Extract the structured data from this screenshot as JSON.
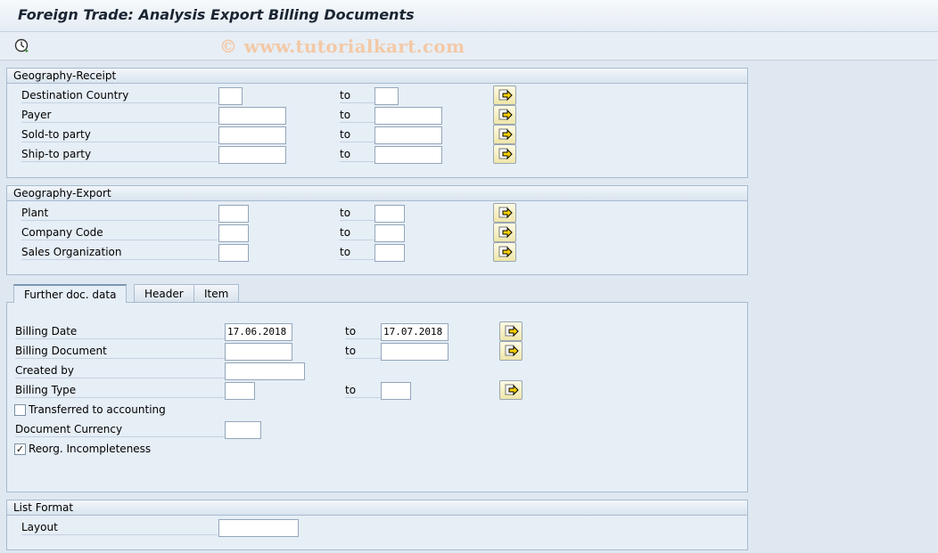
{
  "window": {
    "title": "Foreign Trade: Analysis Export Billing Documents"
  },
  "toolbar": {
    "execute_icon": "clock-execute-icon",
    "watermark": "© www.tutorialkart.com"
  },
  "geography_receipt": {
    "title": "Geography-Receipt",
    "rows": [
      {
        "label": "Destination Country",
        "from": "",
        "to_label": "to",
        "to": ""
      },
      {
        "label": "Payer",
        "from": "",
        "to_label": "to",
        "to": ""
      },
      {
        "label": "Sold-to party",
        "from": "",
        "to_label": "to",
        "to": ""
      },
      {
        "label": "Ship-to party",
        "from": "",
        "to_label": "to",
        "to": ""
      }
    ]
  },
  "geography_export": {
    "title": "Geography-Export",
    "rows": [
      {
        "label": "Plant",
        "from": "",
        "to_label": "to",
        "to": ""
      },
      {
        "label": "Company Code",
        "from": "",
        "to_label": "to",
        "to": ""
      },
      {
        "label": "Sales Organization",
        "from": "",
        "to_label": "to",
        "to": ""
      }
    ]
  },
  "tabs": [
    {
      "label": "Further doc. data",
      "active": true
    },
    {
      "label": "Header",
      "active": false
    },
    {
      "label": "Item",
      "active": false
    }
  ],
  "further": {
    "billing_date": {
      "label": "Billing Date",
      "from": "17.06.2018",
      "to_label": "to",
      "to": "17.07.2018"
    },
    "billing_document": {
      "label": "Billing Document",
      "from": "",
      "to_label": "to",
      "to": ""
    },
    "created_by": {
      "label": "Created by",
      "value": ""
    },
    "billing_type": {
      "label": "Billing Type",
      "from": "",
      "to_label": "to",
      "to": ""
    },
    "transferred": {
      "label": "Transferred to accounting",
      "checked": false
    },
    "document_currency": {
      "label": "Document Currency",
      "value": ""
    },
    "reorg": {
      "label": "Reorg. Incompleteness",
      "checked": true,
      "mark": "✓"
    }
  },
  "list_format": {
    "title": "List Format",
    "layout_label": "Layout",
    "layout_value": ""
  },
  "colors": {
    "background": "#dfe8f1",
    "group_bg": "#e6eef6",
    "button_yellow": "#f2e9ad"
  }
}
